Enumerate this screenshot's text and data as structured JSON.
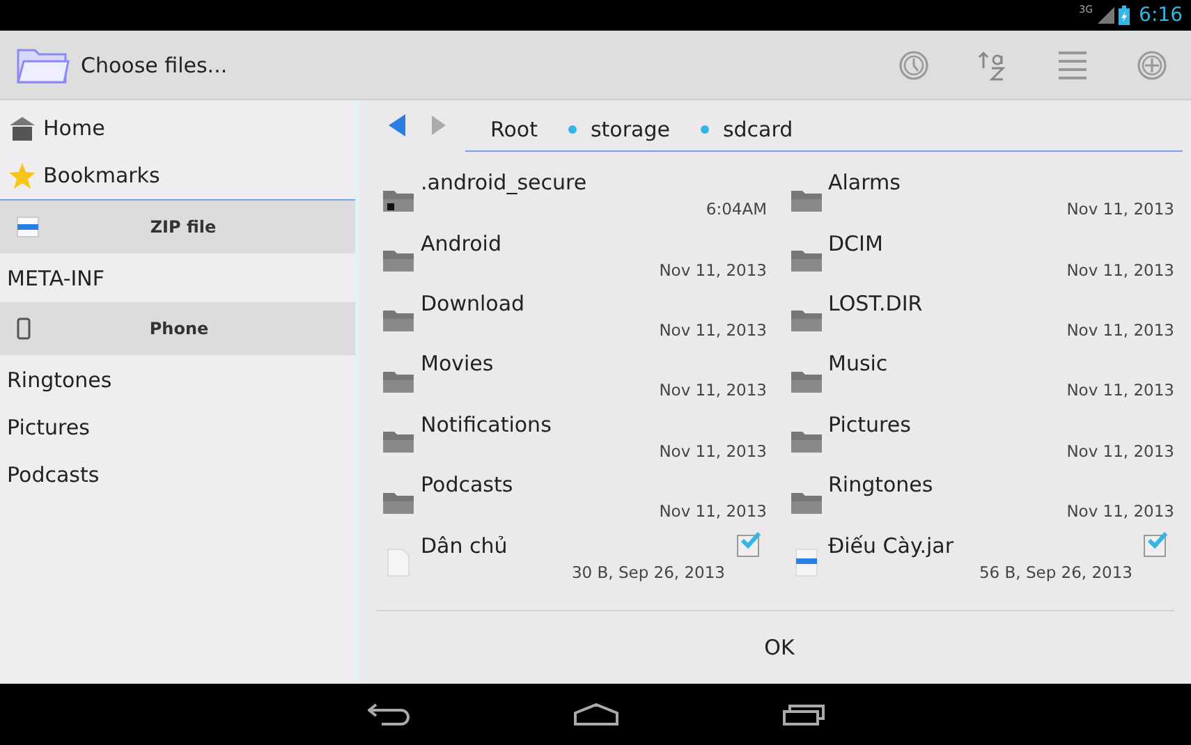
{
  "status_bar": {
    "time": "6:16",
    "network": "3G"
  },
  "action_bar": {
    "title": "Choose files..."
  },
  "sidebar": {
    "items": [
      {
        "kind": "home",
        "label": "Home"
      },
      {
        "kind": "bookmarks",
        "label": "Bookmarks"
      },
      {
        "kind": "zip-section",
        "label": "ZIP file"
      },
      {
        "kind": "folder",
        "label": "META-INF"
      },
      {
        "kind": "phone-section",
        "label": "Phone"
      },
      {
        "kind": "folder",
        "label": "Ringtones"
      },
      {
        "kind": "folder",
        "label": "Pictures"
      },
      {
        "kind": "folder",
        "label": "Podcasts"
      }
    ]
  },
  "breadcrumb": [
    "Root",
    "storage",
    "sdcard"
  ],
  "files": [
    {
      "kind": "folder",
      "name": ".android_secure",
      "meta": "6:04AM",
      "locked": true
    },
    {
      "kind": "folder",
      "name": "Alarms",
      "meta": "Nov 11, 2013",
      "locked": false
    },
    {
      "kind": "folder",
      "name": "Android",
      "meta": "Nov 11, 2013",
      "locked": false
    },
    {
      "kind": "folder",
      "name": "DCIM",
      "meta": "Nov 11, 2013",
      "locked": false
    },
    {
      "kind": "folder",
      "name": "Download",
      "meta": "Nov 11, 2013",
      "locked": false
    },
    {
      "kind": "folder",
      "name": "LOST.DIR",
      "meta": "Nov 11, 2013",
      "locked": false
    },
    {
      "kind": "folder",
      "name": "Movies",
      "meta": "Nov 11, 2013",
      "locked": false
    },
    {
      "kind": "folder",
      "name": "Music",
      "meta": "Nov 11, 2013",
      "locked": false
    },
    {
      "kind": "folder",
      "name": "Notifications",
      "meta": "Nov 11, 2013",
      "locked": false
    },
    {
      "kind": "folder",
      "name": "Pictures",
      "meta": "Nov 11, 2013",
      "locked": false
    },
    {
      "kind": "folder",
      "name": "Podcasts",
      "meta": "Nov 11, 2013",
      "locked": false
    },
    {
      "kind": "folder",
      "name": "Ringtones",
      "meta": "Nov 11, 2013",
      "locked": false
    },
    {
      "kind": "file",
      "name": "Dân chủ",
      "meta": "30 B, Sep 26, 2013",
      "checked": true
    },
    {
      "kind": "archive",
      "name": "Điếu Cày.jar",
      "meta": "56 B, Sep 26, 2013",
      "checked": true
    }
  ],
  "ok_button": "OK"
}
